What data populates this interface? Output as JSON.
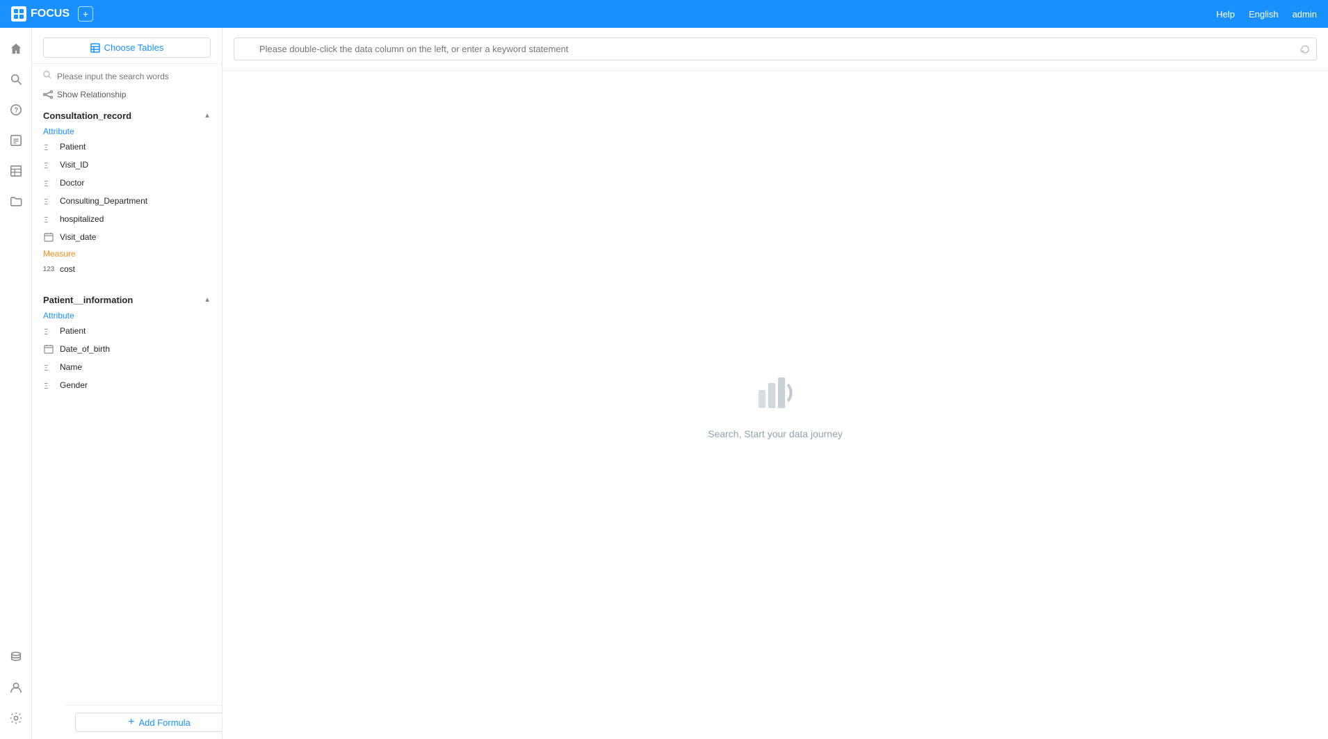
{
  "app": {
    "brand_name": "FOCUS",
    "add_tab_label": "+",
    "nav_right": {
      "help": "Help",
      "language": "English",
      "user": "admin"
    }
  },
  "left_panel": {
    "choose_tables_label": "Choose Tables",
    "search_placeholder": "Please input the search words",
    "show_relationship_label": "Show Relationship",
    "add_formula_label": "Add Formula",
    "tables": [
      {
        "name": "Consultation_record",
        "expanded": true,
        "attribute_label": "Attribute",
        "attributes": [
          {
            "name": "Patient",
            "type": "string"
          },
          {
            "name": "Visit_ID",
            "type": "string"
          },
          {
            "name": "Doctor",
            "type": "string"
          },
          {
            "name": "Consulting_Department",
            "type": "string"
          },
          {
            "name": "hospitalized",
            "type": "string"
          },
          {
            "name": "Visit_date",
            "type": "date"
          }
        ],
        "measure_label": "Measure",
        "measures": [
          {
            "name": "cost",
            "type": "number"
          }
        ]
      },
      {
        "name": "Patient__information",
        "expanded": true,
        "attribute_label": "Attribute",
        "attributes": [
          {
            "name": "Patient",
            "type": "string"
          },
          {
            "name": "Date_of_birth",
            "type": "date"
          },
          {
            "name": "Name",
            "type": "string"
          },
          {
            "name": "Gender",
            "type": "string"
          }
        ],
        "measure_label": null,
        "measures": []
      }
    ]
  },
  "main": {
    "search_placeholder": "Please double-click the data column on the left, or enter a keyword statement",
    "empty_state_text": "Search, Start your data journey"
  },
  "icons": {
    "home": "⌂",
    "search": "🔍",
    "help_circle": "?",
    "table": "▦",
    "grid": "⊞",
    "folder": "📁",
    "report": "📊",
    "user": "👤",
    "settings": "⚙"
  }
}
